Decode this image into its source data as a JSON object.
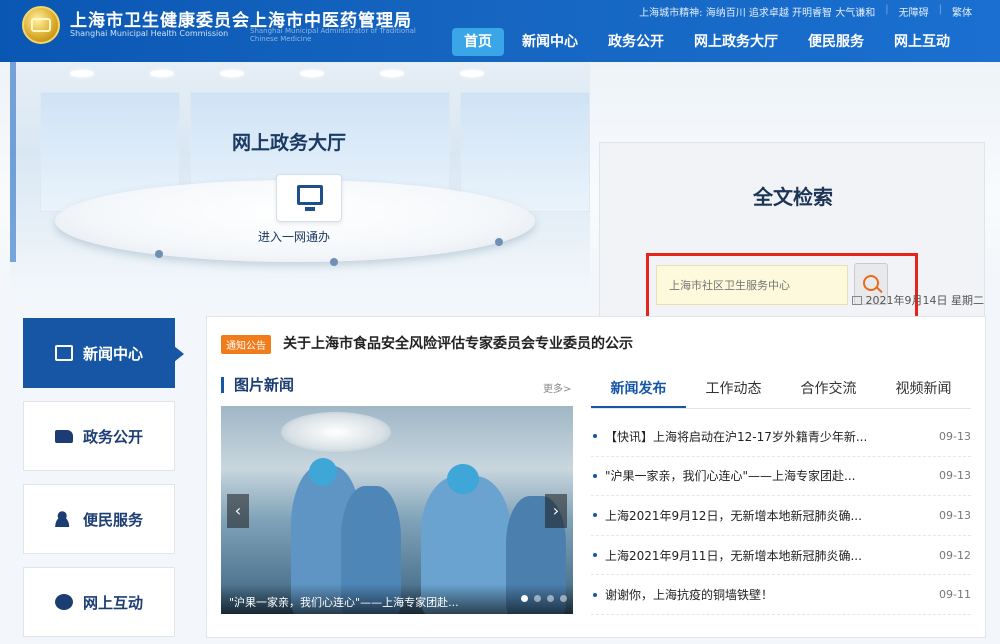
{
  "header": {
    "org1_cn": "上海市卫生健康委员会",
    "org1_en": "Shanghai Municipal Health Commission",
    "org2_cn": "上海市中医药管理局",
    "org2_en": "Shanghai Municipal Administrator of Traditional Chinese Medicine",
    "city_spirit": "上海城市精神: 海纳百川 追求卓越 开明睿智 大气谦和",
    "accessibility": "无障碍",
    "traditional": "繁体",
    "nav": [
      "首页",
      "新闻中心",
      "政务公开",
      "网上政务大厅",
      "便民服务",
      "网上互动"
    ]
  },
  "banner": {
    "hall_title": "网上政务大厅",
    "hall_link": "进入一网通办",
    "search_title": "全文检索",
    "search_placeholder": "上海市社区卫生服务中心",
    "date": "2021年9月14日 星期二"
  },
  "sidebar": {
    "items": [
      "新闻中心",
      "政务公开",
      "便民服务",
      "网上互动"
    ]
  },
  "notice": {
    "tag": "通知公告",
    "text": "关于上海市食品安全风险评估专家委员会专业委员的公示"
  },
  "pictures": {
    "heading": "图片新闻",
    "more": "更多>",
    "caption": "\"沪果一家亲，我们心连心\"——上海专家团赴..."
  },
  "tabs": [
    "新闻发布",
    "工作动态",
    "合作交流",
    "视频新闻"
  ],
  "news": [
    {
      "title": "【快讯】上海将启动在沪12-17岁外籍青少年新...",
      "date": "09-13"
    },
    {
      "title": "\"沪果一家亲，我们心连心\"——上海专家团赴...",
      "date": "09-13"
    },
    {
      "title": "上海2021年9月12日，无新增本地新冠肺炎确...",
      "date": "09-13"
    },
    {
      "title": "上海2021年9月11日，无新增本地新冠肺炎确...",
      "date": "09-12"
    },
    {
      "title": "谢谢你，上海抗疫的铜墙铁壁！",
      "date": "09-11"
    }
  ],
  "colors": {
    "primary": "#1656a5",
    "accent_orange": "#f07c1c",
    "highlight_red": "#e8231b"
  }
}
